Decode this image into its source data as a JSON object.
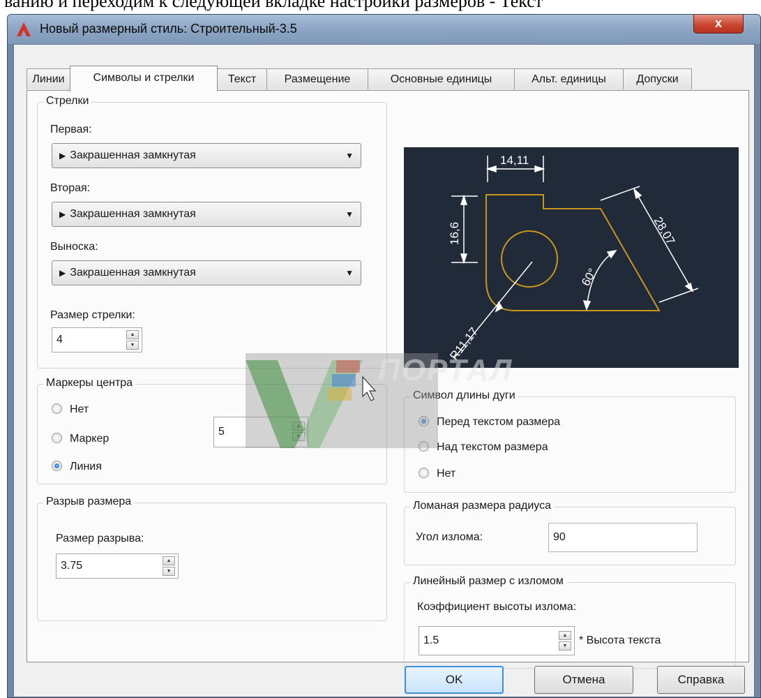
{
  "document": {
    "heading_fragment": "ванию и переходим к следующей вкладке настройки размеров - Текст"
  },
  "window": {
    "title": "Новый размерный стиль: Строительный-3.5",
    "close_label": "x"
  },
  "tabs": [
    {
      "label": "Линии",
      "active": false
    },
    {
      "label": "Символы и стрелки",
      "active": true
    },
    {
      "label": "Текст",
      "active": false
    },
    {
      "label": "Размещение",
      "active": false
    },
    {
      "label": "Основные единицы",
      "active": false
    },
    {
      "label": "Альт. единицы",
      "active": false
    },
    {
      "label": "Допуски",
      "active": false
    }
  ],
  "arrows": {
    "title": "Стрелки",
    "first": {
      "label": "Первая:",
      "value": "Закрашенная замкнутая"
    },
    "second": {
      "label": "Вторая:",
      "value": "Закрашенная замкнутая"
    },
    "leader": {
      "label": "Выноска:",
      "value": "Закрашенная замкнутая"
    },
    "size": {
      "label": "Размер стрелки:",
      "value": "4"
    }
  },
  "center_marks": {
    "title": "Маркеры центра",
    "options": [
      {
        "label": "Нет",
        "selected": false
      },
      {
        "label": "Маркер",
        "selected": false
      },
      {
        "label": "Линия",
        "selected": true
      }
    ],
    "size_value": "5"
  },
  "dimension_break": {
    "title": "Разрыв размера",
    "label": "Размер разрыва:",
    "value": "3.75"
  },
  "preview": {
    "dim_top": "14,11",
    "dim_left": "16,6",
    "dim_diag": "28,07",
    "dim_angle": "60°",
    "dim_radius": "R11,17",
    "colors": {
      "background": "#212a38",
      "outline": "#c8961c",
      "dim_lines": "#ffffff"
    }
  },
  "watermark": {
    "text": "ПОРТАЛ"
  },
  "arc_length": {
    "title": "Символ длины дуги",
    "options": [
      {
        "label": "Перед текстом размера",
        "selected": true
      },
      {
        "label": "Над текстом размера",
        "selected": false
      },
      {
        "label": "Нет",
        "selected": false
      }
    ]
  },
  "radius_jog": {
    "title": "Ломаная размера радиуса",
    "label": "Угол излома:",
    "value": "90"
  },
  "linear_jog": {
    "title": "Линейный размер с изломом",
    "label": "Коэффициент высоты излома:",
    "value": "1.5",
    "suffix": "* Высота текста"
  },
  "buttons": {
    "ok": "OK",
    "cancel": "Отмена",
    "help": "Справка"
  }
}
